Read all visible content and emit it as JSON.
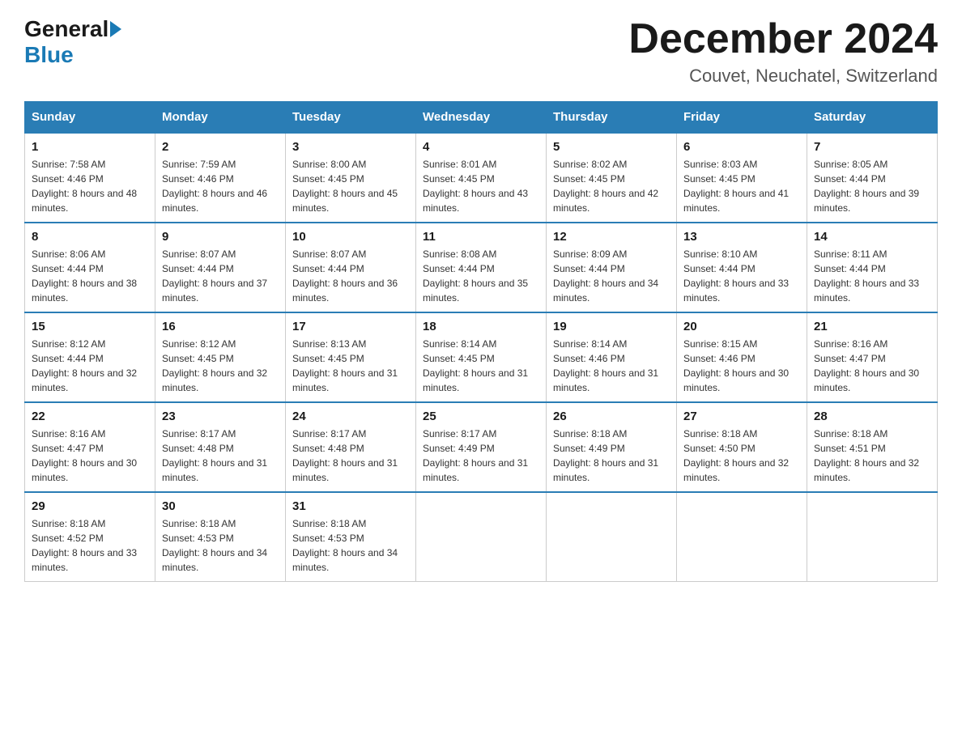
{
  "logo": {
    "general": "General",
    "blue": "Blue"
  },
  "title": "December 2024",
  "location": "Couvet, Neuchatel, Switzerland",
  "weekdays": [
    "Sunday",
    "Monday",
    "Tuesday",
    "Wednesday",
    "Thursday",
    "Friday",
    "Saturday"
  ],
  "weeks": [
    [
      {
        "day": "1",
        "sunrise": "7:58 AM",
        "sunset": "4:46 PM",
        "daylight": "8 hours and 48 minutes."
      },
      {
        "day": "2",
        "sunrise": "7:59 AM",
        "sunset": "4:46 PM",
        "daylight": "8 hours and 46 minutes."
      },
      {
        "day": "3",
        "sunrise": "8:00 AM",
        "sunset": "4:45 PM",
        "daylight": "8 hours and 45 minutes."
      },
      {
        "day": "4",
        "sunrise": "8:01 AM",
        "sunset": "4:45 PM",
        "daylight": "8 hours and 43 minutes."
      },
      {
        "day": "5",
        "sunrise": "8:02 AM",
        "sunset": "4:45 PM",
        "daylight": "8 hours and 42 minutes."
      },
      {
        "day": "6",
        "sunrise": "8:03 AM",
        "sunset": "4:45 PM",
        "daylight": "8 hours and 41 minutes."
      },
      {
        "day": "7",
        "sunrise": "8:05 AM",
        "sunset": "4:44 PM",
        "daylight": "8 hours and 39 minutes."
      }
    ],
    [
      {
        "day": "8",
        "sunrise": "8:06 AM",
        "sunset": "4:44 PM",
        "daylight": "8 hours and 38 minutes."
      },
      {
        "day": "9",
        "sunrise": "8:07 AM",
        "sunset": "4:44 PM",
        "daylight": "8 hours and 37 minutes."
      },
      {
        "day": "10",
        "sunrise": "8:07 AM",
        "sunset": "4:44 PM",
        "daylight": "8 hours and 36 minutes."
      },
      {
        "day": "11",
        "sunrise": "8:08 AM",
        "sunset": "4:44 PM",
        "daylight": "8 hours and 35 minutes."
      },
      {
        "day": "12",
        "sunrise": "8:09 AM",
        "sunset": "4:44 PM",
        "daylight": "8 hours and 34 minutes."
      },
      {
        "day": "13",
        "sunrise": "8:10 AM",
        "sunset": "4:44 PM",
        "daylight": "8 hours and 33 minutes."
      },
      {
        "day": "14",
        "sunrise": "8:11 AM",
        "sunset": "4:44 PM",
        "daylight": "8 hours and 33 minutes."
      }
    ],
    [
      {
        "day": "15",
        "sunrise": "8:12 AM",
        "sunset": "4:44 PM",
        "daylight": "8 hours and 32 minutes."
      },
      {
        "day": "16",
        "sunrise": "8:12 AM",
        "sunset": "4:45 PM",
        "daylight": "8 hours and 32 minutes."
      },
      {
        "day": "17",
        "sunrise": "8:13 AM",
        "sunset": "4:45 PM",
        "daylight": "8 hours and 31 minutes."
      },
      {
        "day": "18",
        "sunrise": "8:14 AM",
        "sunset": "4:45 PM",
        "daylight": "8 hours and 31 minutes."
      },
      {
        "day": "19",
        "sunrise": "8:14 AM",
        "sunset": "4:46 PM",
        "daylight": "8 hours and 31 minutes."
      },
      {
        "day": "20",
        "sunrise": "8:15 AM",
        "sunset": "4:46 PM",
        "daylight": "8 hours and 30 minutes."
      },
      {
        "day": "21",
        "sunrise": "8:16 AM",
        "sunset": "4:47 PM",
        "daylight": "8 hours and 30 minutes."
      }
    ],
    [
      {
        "day": "22",
        "sunrise": "8:16 AM",
        "sunset": "4:47 PM",
        "daylight": "8 hours and 30 minutes."
      },
      {
        "day": "23",
        "sunrise": "8:17 AM",
        "sunset": "4:48 PM",
        "daylight": "8 hours and 31 minutes."
      },
      {
        "day": "24",
        "sunrise": "8:17 AM",
        "sunset": "4:48 PM",
        "daylight": "8 hours and 31 minutes."
      },
      {
        "day": "25",
        "sunrise": "8:17 AM",
        "sunset": "4:49 PM",
        "daylight": "8 hours and 31 minutes."
      },
      {
        "day": "26",
        "sunrise": "8:18 AM",
        "sunset": "4:49 PM",
        "daylight": "8 hours and 31 minutes."
      },
      {
        "day": "27",
        "sunrise": "8:18 AM",
        "sunset": "4:50 PM",
        "daylight": "8 hours and 32 minutes."
      },
      {
        "day": "28",
        "sunrise": "8:18 AM",
        "sunset": "4:51 PM",
        "daylight": "8 hours and 32 minutes."
      }
    ],
    [
      {
        "day": "29",
        "sunrise": "8:18 AM",
        "sunset": "4:52 PM",
        "daylight": "8 hours and 33 minutes."
      },
      {
        "day": "30",
        "sunrise": "8:18 AM",
        "sunset": "4:53 PM",
        "daylight": "8 hours and 34 minutes."
      },
      {
        "day": "31",
        "sunrise": "8:18 AM",
        "sunset": "4:53 PM",
        "daylight": "8 hours and 34 minutes."
      },
      null,
      null,
      null,
      null
    ]
  ]
}
